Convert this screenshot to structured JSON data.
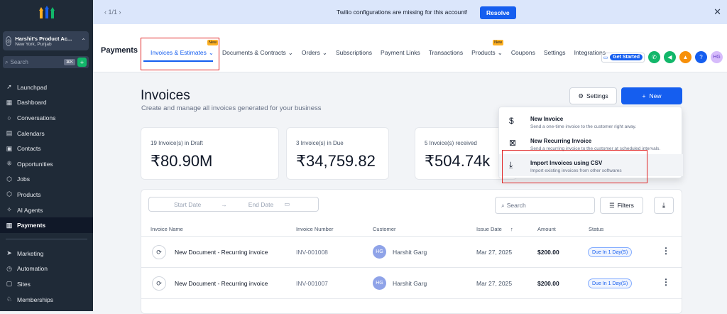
{
  "sidebar": {
    "account_name": "Harshit's Product Ac...",
    "account_location": "New York, Punjab",
    "search_placeholder": "Search",
    "search_shortcut": "⌘K",
    "items": [
      {
        "label": "Launchpad",
        "icon": "rocket-icon"
      },
      {
        "label": "Dashboard",
        "icon": "grid-icon"
      },
      {
        "label": "Conversations",
        "icon": "chat-icon"
      },
      {
        "label": "Calendars",
        "icon": "calendar-icon"
      },
      {
        "label": "Contacts",
        "icon": "contacts-icon"
      },
      {
        "label": "Opportunities",
        "icon": "opportunities-icon"
      },
      {
        "label": "Jobs",
        "icon": "box-icon"
      },
      {
        "label": "Products",
        "icon": "box-icon"
      },
      {
        "label": "AI Agents",
        "icon": "sparkle-icon"
      },
      {
        "label": "Payments",
        "icon": "receipt-icon"
      },
      {
        "label": "Marketing",
        "icon": "send-icon"
      },
      {
        "label": "Automation",
        "icon": "automation-icon"
      },
      {
        "label": "Sites",
        "icon": "sites-icon"
      },
      {
        "label": "Memberships",
        "icon": "badge-icon"
      }
    ]
  },
  "banner": {
    "pager": "1/1",
    "message": "Twilio configurations are missing for this account!",
    "resolve": "Resolve"
  },
  "topnav": {
    "section_title": "Payments",
    "get_started": "Get Started",
    "avatar_initials": "HG",
    "new_badge": "New",
    "tabs": [
      {
        "label": "Invoices & Estimates"
      },
      {
        "label": "Documents & Contracts"
      },
      {
        "label": "Orders"
      },
      {
        "label": "Subscriptions"
      },
      {
        "label": "Payment Links"
      },
      {
        "label": "Transactions"
      },
      {
        "label": "Products"
      },
      {
        "label": "Coupons"
      },
      {
        "label": "Settings"
      },
      {
        "label": "Integrations"
      }
    ]
  },
  "page": {
    "title": "Invoices",
    "subtitle": "Create and manage all invoices generated for your business",
    "settings_btn": "Settings",
    "new_btn": "New"
  },
  "cards": [
    {
      "label": "19 Invoice(s) in Draft",
      "value": "₹80.90M"
    },
    {
      "label": "3 Invoice(s) in Due",
      "value": "₹34,759.82"
    },
    {
      "label": "5 Invoice(s) received",
      "value": "₹504.74k"
    }
  ],
  "dropdown": [
    {
      "title": "New Invoice",
      "desc": "Send a one-time invoice to the customer right away.",
      "icon": "dollar-icon"
    },
    {
      "title": "New Recurring Invoice",
      "desc": "Send a recurring invoice to the customer at scheduled intervals.",
      "icon": "recurring-icon"
    },
    {
      "title": "Import Invoices using CSV",
      "desc": "Import existing invoices from other softwares",
      "icon": "download-icon"
    }
  ],
  "table": {
    "start_date": "Start Date",
    "end_date": "End Date",
    "search_placeholder": "Search",
    "filters": "Filters",
    "headers": [
      "Invoice Name",
      "Invoice Number",
      "Customer",
      "Issue Date",
      "Amount",
      "Status"
    ],
    "rows": [
      {
        "name": "New Document - Recurring invoice",
        "number": "INV-001008",
        "customer": "Harshit Garg",
        "initials": "HG",
        "date": "Mar 27, 2025",
        "amount": "$200.00",
        "status": "Due In 1 Day(S)"
      },
      {
        "name": "New Document - Recurring invoice",
        "number": "INV-001007",
        "customer": "Harshit Garg",
        "initials": "HG",
        "date": "Mar 27, 2025",
        "amount": "$200.00",
        "status": "Due In 1 Day(S)"
      }
    ]
  },
  "colors": {
    "primary": "#155eef",
    "sidebar": "#1f2a37",
    "highlight": "#e02424"
  }
}
